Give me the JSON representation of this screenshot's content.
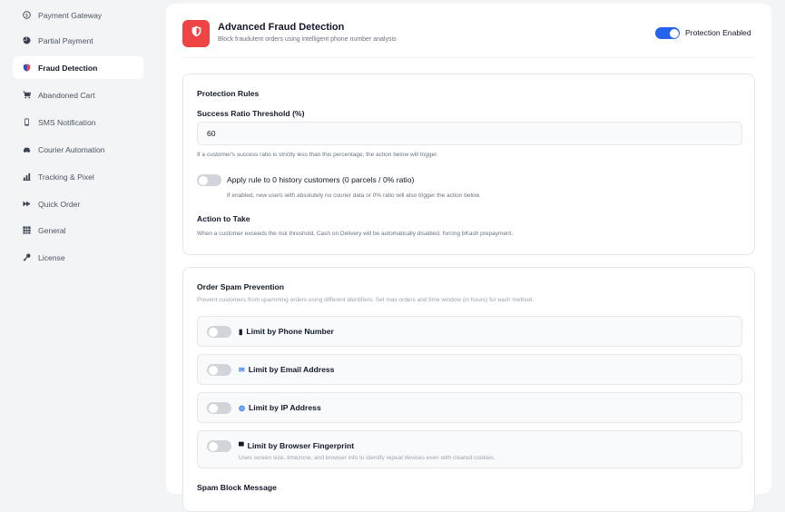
{
  "sidebar": {
    "items": [
      {
        "label": "Payment Gateway",
        "icon": "dollar-circle-icon"
      },
      {
        "label": "Partial Payment",
        "icon": "pie-chart-icon"
      },
      {
        "label": "Fraud Detection",
        "icon": "shield-icon",
        "active": true
      },
      {
        "label": "Abandoned Cart",
        "icon": "cart-icon"
      },
      {
        "label": "SMS Notification",
        "icon": "phone-icon"
      },
      {
        "label": "Courier Automation",
        "icon": "car-icon"
      },
      {
        "label": "Tracking & Pixel",
        "icon": "bar-chart-icon"
      },
      {
        "label": "Quick Order",
        "icon": "fast-forward-icon"
      },
      {
        "label": "General",
        "icon": "grid-icon"
      },
      {
        "label": "License",
        "icon": "key-icon"
      }
    ]
  },
  "header": {
    "title": "Advanced Fraud Detection",
    "subtitle": "Block fraudulent orders using intelligent phone number analysis",
    "protection_label": "Protection Enabled",
    "protection_on": true
  },
  "protection_rules": {
    "title": "Protection Rules",
    "threshold_label": "Success Ratio Threshold (%)",
    "threshold_value": "60",
    "threshold_help": "If a customer's success ratio is strictly less than this percentage, the action below will trigger.",
    "zero_history_label": "Apply rule to 0 history customers (0 parcels / 0% ratio)",
    "zero_history_help": "If enabled, new users with absolutely no courier data or 0% ratio will also trigger the action below.",
    "zero_history_on": false,
    "action_title": "Action to Take",
    "action_help": "When a customer exceeds the risk threshold, Cash on Delivery will be automatically disabled, forcing bKash prepayment."
  },
  "spam": {
    "title": "Order Spam Prevention",
    "description": "Prevent customers from spamming orders using different identifiers. Set max orders and time window (in hours) for each method.",
    "limits": [
      {
        "label": "Limit by Phone Number",
        "icon": "mobile-phone-icon",
        "glyph": "▮",
        "on": false
      },
      {
        "label": "Limit by Email Address",
        "icon": "email-icon",
        "glyph": "✉",
        "on": false
      },
      {
        "label": "Limit by IP Address",
        "icon": "globe-icon",
        "glyph": "◍",
        "on": false
      },
      {
        "label": "Limit by Browser Fingerprint",
        "icon": "monitor-icon",
        "glyph": "▀",
        "on": false,
        "help": "Uses screen size, timezone, and browser info to identify repeat devices even with cleared cookies."
      }
    ],
    "block_message_label": "Spam Block Message"
  }
}
